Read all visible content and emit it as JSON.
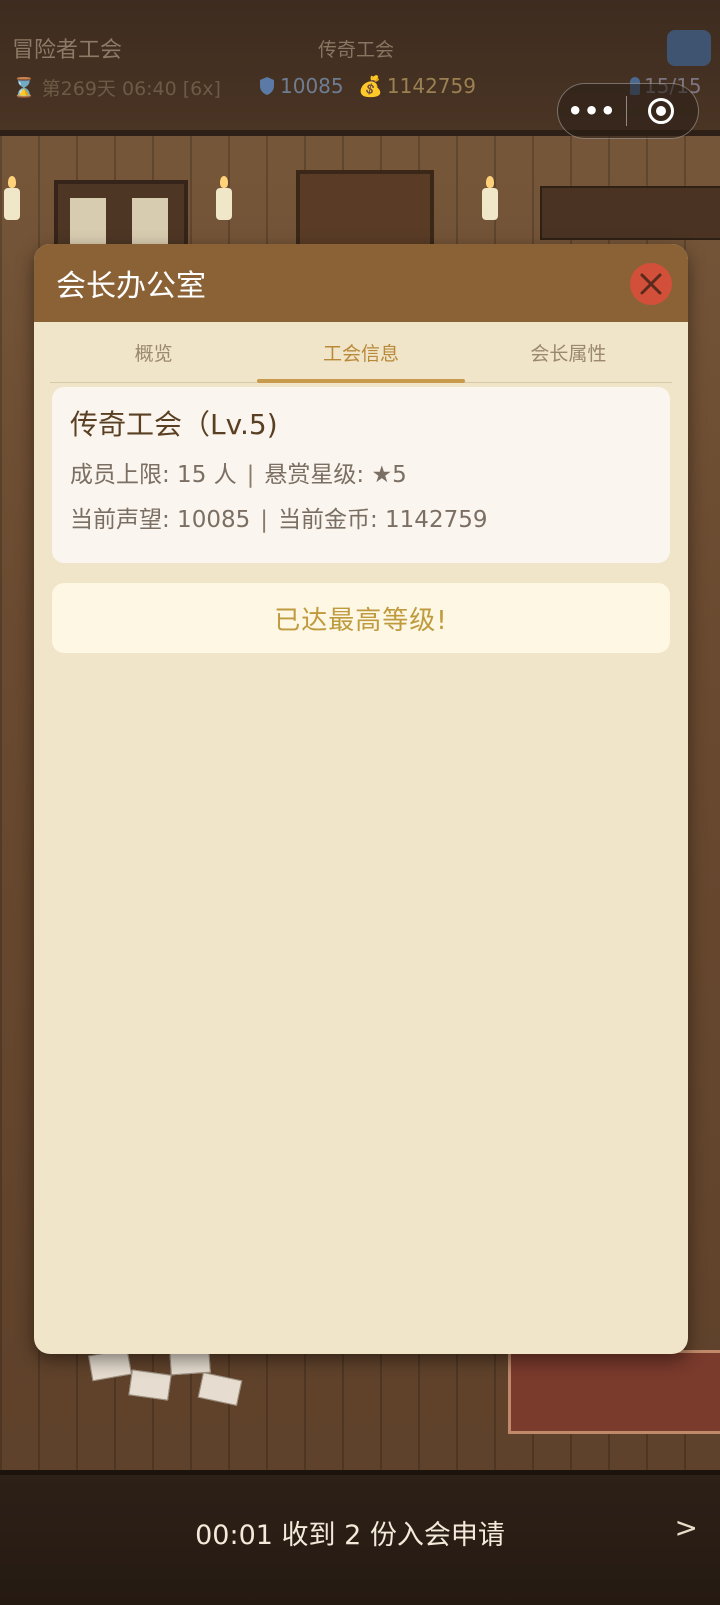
{
  "header": {
    "game_title": "冒险者工会",
    "guild_label": "传奇工会",
    "day_text": "第269天 06:40 [6x]",
    "reputation": "10085",
    "gold": "1142759",
    "members": "15/15",
    "more_glyph": "•••"
  },
  "modal": {
    "title": "会长办公室",
    "tabs": [
      {
        "label": "概览",
        "active": false
      },
      {
        "label": "工会信息",
        "active": true
      },
      {
        "label": "会长属性",
        "active": false
      }
    ],
    "guild_name": "传奇工会（Lv.5)",
    "member_limit": "成员上限: 15 人",
    "bounty_stars": "悬赏星级: ★5",
    "current_rep": "当前声望: 10085",
    "current_gold": "当前金币: 1142759",
    "separator": "|",
    "max_level_text": "已达最高等级!"
  },
  "notice": {
    "text": "00:01 收到 2 份入会申请",
    "arrow": ">"
  },
  "colors": {
    "modal_header": "#8a6236",
    "modal_body": "#f0e4c9",
    "close_button": "#d2503a",
    "active_tab": "#b9893a",
    "max_level_text": "#c09a3e"
  },
  "icons": {
    "hourglass": "hourglass-icon",
    "shield": "shield-icon",
    "money_bag": "money-bag-icon",
    "person": "person-icon",
    "close": "close-icon",
    "target": "target-icon"
  }
}
